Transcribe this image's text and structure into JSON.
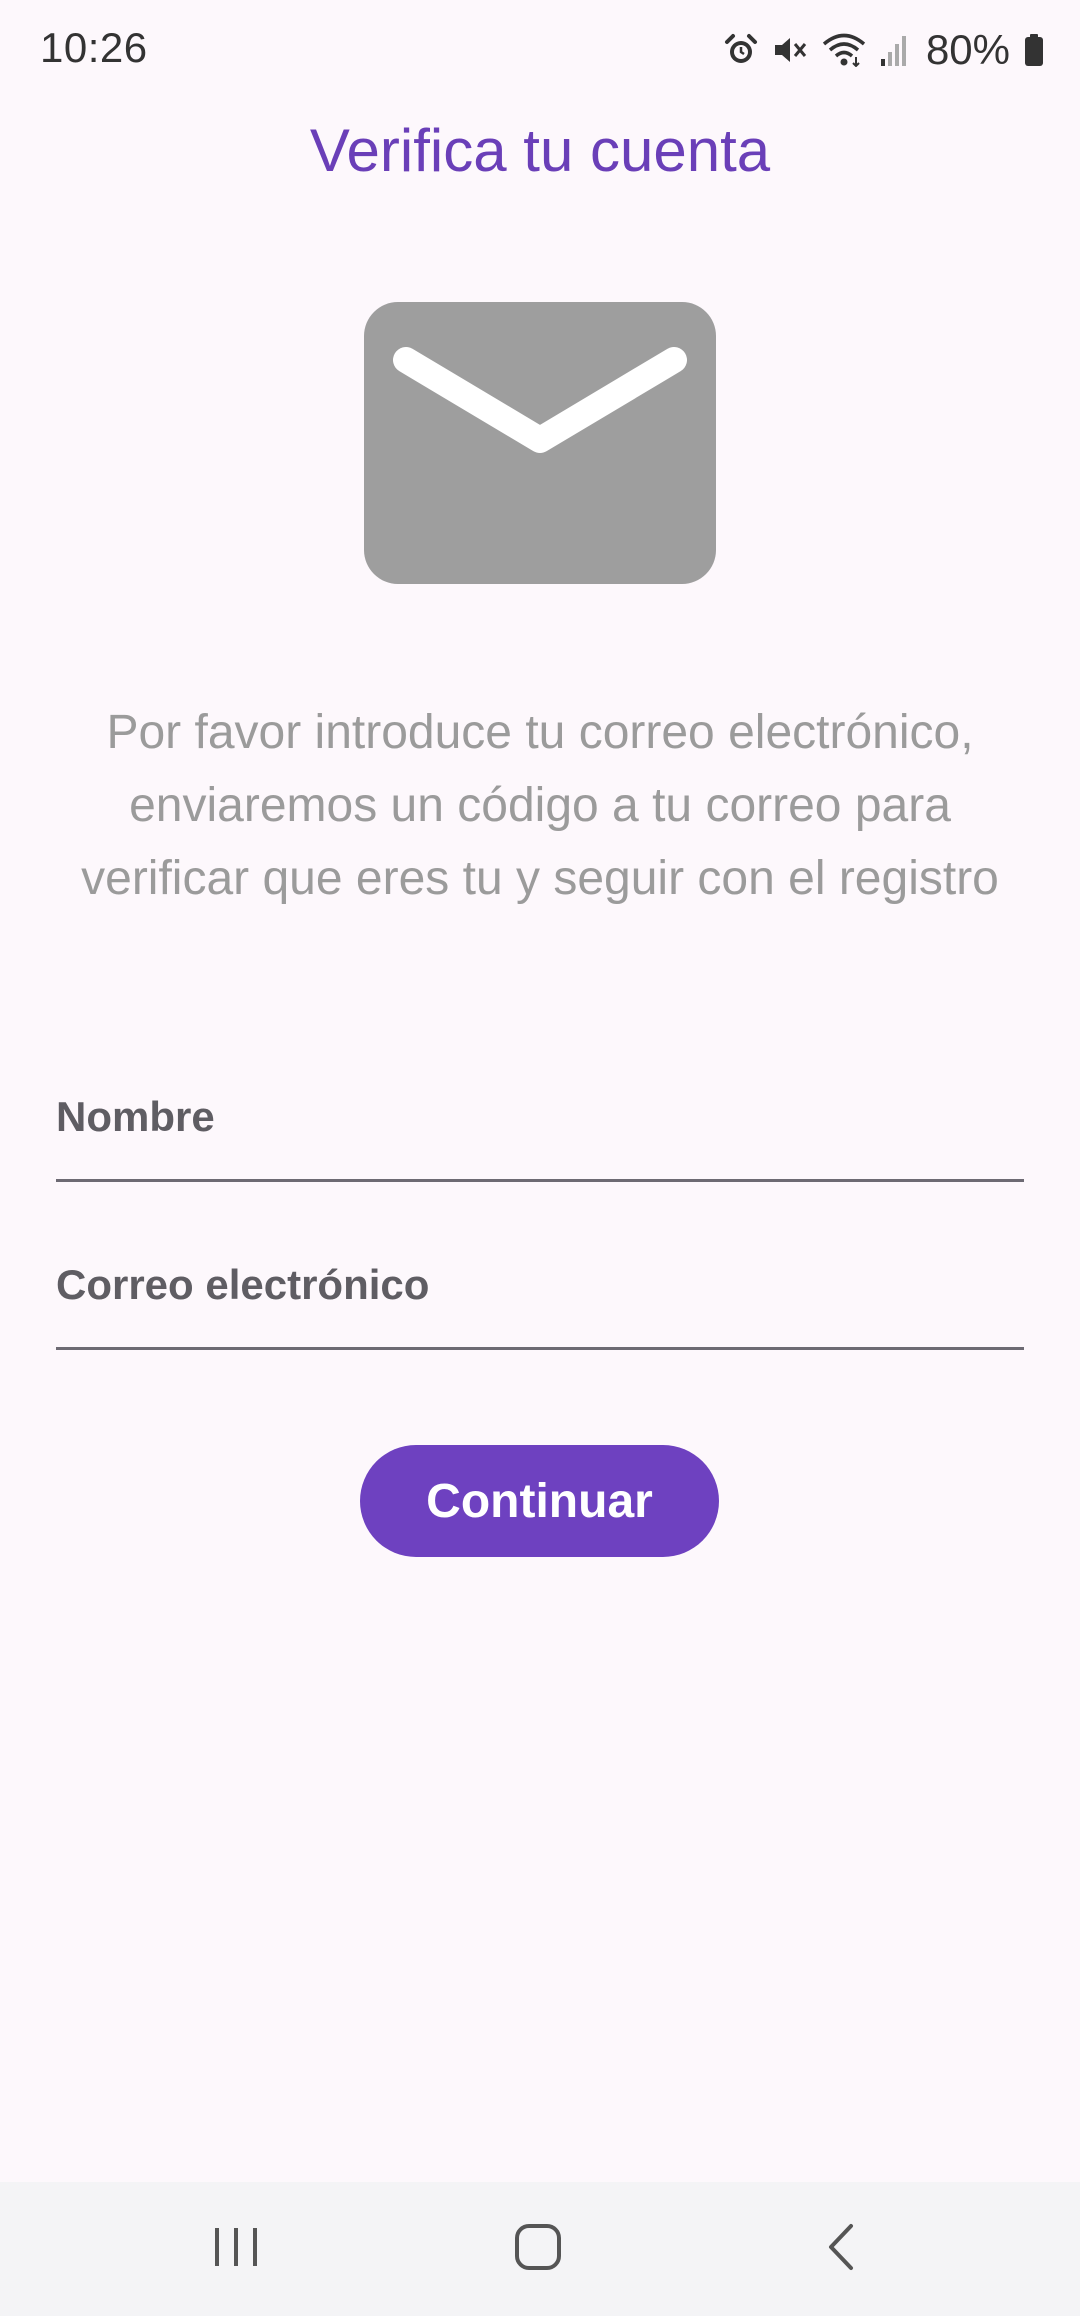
{
  "status_bar": {
    "time": "10:26",
    "battery_percent": "80%",
    "icons": [
      "alarm-icon",
      "mute-icon",
      "wifi-icon",
      "signal-icon",
      "battery-icon"
    ]
  },
  "header": {
    "title": "Verifica tu cuenta"
  },
  "illustration": {
    "icon": "envelope-icon",
    "color": "#9e9e9e"
  },
  "description": "Por favor introduce tu correo electrónico, enviaremos un código a tu correo para verificar que eres tu y seguir con el registro",
  "form": {
    "name_label": "Nombre",
    "email_label": "Correo electrónico"
  },
  "actions": {
    "continue_label": "Continuar"
  },
  "nav_bar": {
    "buttons": [
      "recents-icon",
      "home-icon",
      "back-icon"
    ]
  },
  "colors": {
    "accent": "#6e41c0",
    "title": "#6a3fb8",
    "background": "#fdf8fc"
  }
}
